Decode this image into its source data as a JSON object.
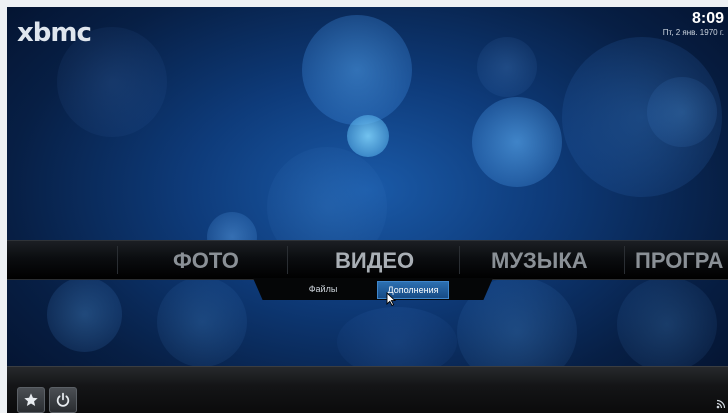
{
  "app": {
    "logo": "xbmc"
  },
  "clock": {
    "time": "8:09",
    "date": "Пт, 2 янв. 1970 г."
  },
  "main_menu": {
    "items": [
      {
        "label": "ФОТО"
      },
      {
        "label": "ВИДЕО"
      },
      {
        "label": "МУЗЫКА"
      },
      {
        "label": "ПРОГРА"
      }
    ],
    "selected": "ВИДЕО"
  },
  "submenu": {
    "items": [
      {
        "label": "Файлы"
      },
      {
        "label": "Дополнения"
      }
    ],
    "active": "Дополнения"
  },
  "bottom_bar": {
    "buttons": [
      {
        "icon": "star-icon"
      },
      {
        "icon": "power-icon"
      }
    ]
  },
  "colors": {
    "accent": "#2c6fb0",
    "background": "#0e3b7a",
    "menu_text": "#8a9096"
  }
}
